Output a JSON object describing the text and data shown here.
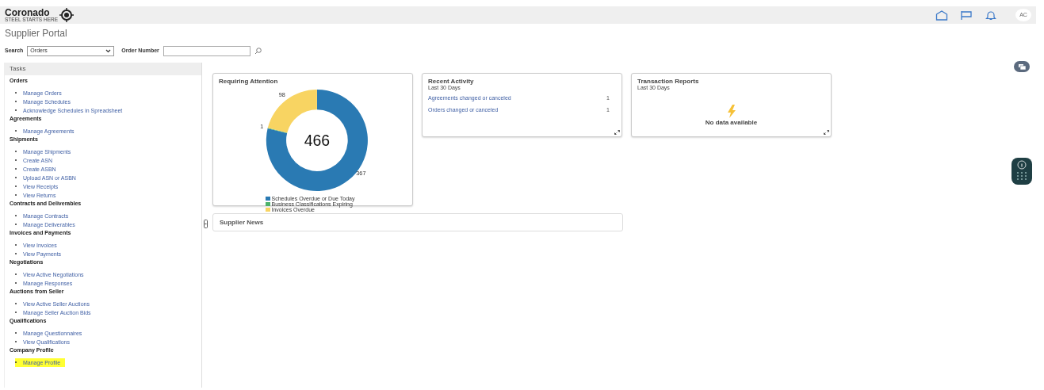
{
  "header": {
    "logo_text": "Coronado",
    "logo_tagline": "STEEL STARTS HERE",
    "avatar_initials": "AC"
  },
  "page_title": "Supplier Portal",
  "search": {
    "label": "Search",
    "selected_option": "Orders",
    "field_label": "Order Number"
  },
  "tasks": {
    "title": "Tasks",
    "groups": [
      {
        "title": "Orders",
        "items": [
          {
            "label": "Manage Orders",
            "highlighted": false
          },
          {
            "label": "Manage Schedules",
            "highlighted": false
          },
          {
            "label": "Acknowledge Schedules in Spreadsheet",
            "highlighted": false
          }
        ]
      },
      {
        "title": "Agreements",
        "items": [
          {
            "label": "Manage Agreements",
            "highlighted": false
          }
        ]
      },
      {
        "title": "Shipments",
        "items": [
          {
            "label": "Manage Shipments",
            "highlighted": false
          },
          {
            "label": "Create ASN",
            "highlighted": false
          },
          {
            "label": "Create ASBN",
            "highlighted": false
          },
          {
            "label": "Upload ASN or ASBN",
            "highlighted": false
          },
          {
            "label": "View Receipts",
            "highlighted": false
          },
          {
            "label": "View Returns",
            "highlighted": false
          }
        ]
      },
      {
        "title": "Contracts and Deliverables",
        "items": [
          {
            "label": "Manage Contracts",
            "highlighted": false
          },
          {
            "label": "Manage Deliverables",
            "highlighted": false
          }
        ]
      },
      {
        "title": "Invoices and Payments",
        "items": [
          {
            "label": "View Invoices",
            "highlighted": false
          },
          {
            "label": "View Payments",
            "highlighted": false
          }
        ]
      },
      {
        "title": "Negotiations",
        "items": [
          {
            "label": "View Active Negotiations",
            "highlighted": false
          },
          {
            "label": "Manage Responses",
            "highlighted": false
          }
        ]
      },
      {
        "title": "Auctions from Seller",
        "items": [
          {
            "label": "View Active Seller Auctions",
            "highlighted": false
          },
          {
            "label": "Manage Seller Auction Bids",
            "highlighted": false
          }
        ]
      },
      {
        "title": "Qualifications",
        "items": [
          {
            "label": "Manage Questionnaires",
            "highlighted": false
          },
          {
            "label": "View Qualifications",
            "highlighted": false
          }
        ]
      },
      {
        "title": "Company Profile",
        "items": [
          {
            "label": "Manage Profile",
            "highlighted": true
          }
        ]
      }
    ]
  },
  "cards": [
    {
      "kind": "chart",
      "title": "Requiring Attention",
      "center_value": "466",
      "chart_data": {
        "type": "donut",
        "categories": [
          "Schedules Overdue or Due Today",
          "Business Classifications Expiring",
          "Invoices Overdue"
        ],
        "series": [
          {
            "values": [
              367,
              1,
              98
            ]
          }
        ],
        "data_labels": true
      }
    },
    {
      "kind": "list",
      "title": "Recent Activity",
      "subtitle": "Last 30 Days",
      "rows": [
        {
          "label": "Agreements changed or canceled",
          "count": "1"
        },
        {
          "label": "Orders changed or canceled",
          "count": "1"
        }
      ]
    },
    {
      "kind": "empty",
      "title": "Transaction Reports",
      "subtitle": "Last 30 Days",
      "message": "No data available"
    }
  ],
  "news": {
    "title": "Supplier News"
  }
}
